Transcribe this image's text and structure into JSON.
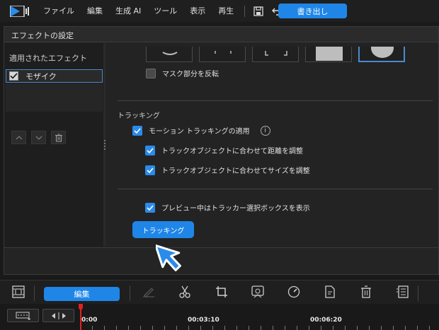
{
  "menubar": {
    "items": [
      "ファイル",
      "編集",
      "生成 AI",
      "ツール",
      "表示",
      "再生"
    ],
    "export_label": "書き出し"
  },
  "dialog": {
    "title": "エフェクトの設定",
    "applied_effects_header": "適用されたエフェクト",
    "effects": [
      {
        "label": "モザイク",
        "checked": true
      }
    ],
    "mask_invert_label": "マスク部分を反転",
    "mask_invert_checked": false,
    "tracking_section_label": "トラッキング",
    "motion_tracking_label": "モーション トラッキングの適用",
    "motion_tracking_checked": true,
    "adjust_distance_label": "トラックオブジェクトに合わせて距離を調整",
    "adjust_distance_checked": true,
    "adjust_size_label": "トラックオブジェクトに合わせてサイズを調整",
    "adjust_size_checked": true,
    "show_tracker_label": "プレビュー中はトラッカー選択ボックスを表示",
    "show_tracker_checked": true,
    "tracking_button_label": "トラッキング"
  },
  "bottom_toolbar": {
    "edit_label": "編集"
  },
  "timeline": {
    "time_labels": [
      "0:00",
      "00:03:10",
      "00:06:20"
    ]
  },
  "colors": {
    "accent": "#1f86e8",
    "background": "#1a1a1a",
    "playhead": "#e02020"
  }
}
